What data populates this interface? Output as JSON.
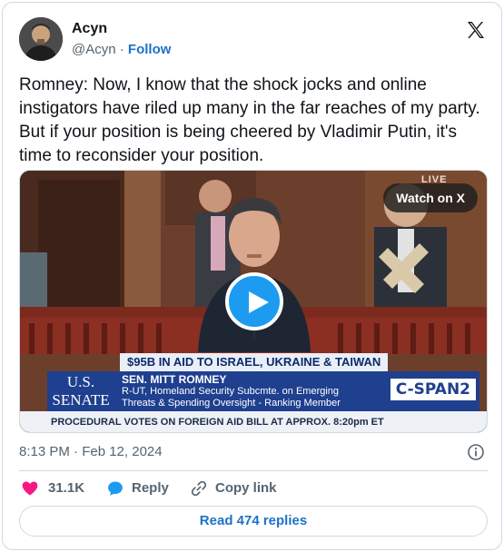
{
  "author": {
    "name": "Acyn",
    "handle": "@Acyn",
    "separator": "·",
    "follow_label": "Follow"
  },
  "tweet": {
    "text": "Romney: Now, I know that the shock jocks and online instigators have riled up many in the far reaches of my party. But if your position is being cheered by Vladimir Putin, it's time to reconsider your position.",
    "timestamp": "8:13 PM · Feb 12, 2024"
  },
  "media": {
    "watch_label": "Watch on X",
    "live_tag": "LIVE",
    "chyron_headline": "$95B IN AID TO ISRAEL, UKRAINE & TAIWAN",
    "senate_line1": "U.S.",
    "senate_line2": "SENATE",
    "speaker_name": "SEN. MITT ROMNEY",
    "speaker_desc1": "R-UT, Homeland Security Subcmte. on Emerging",
    "speaker_desc2": "Threats & Spending Oversight - Ranking Member",
    "network": "C-SPAN2",
    "ticker": "PROCEDURAL VOTES ON FOREIGN AID BILL AT APPROX. 8:20pm ET"
  },
  "actions": {
    "like_count": "31.1K",
    "reply_label": "Reply",
    "copy_label": "Copy link"
  },
  "read_replies_label": "Read 474 replies",
  "colors": {
    "accent": "#1d9bf0",
    "link": "#1d72c7",
    "like": "#f91880",
    "muted": "#536471",
    "border": "#cfd9de"
  },
  "icons": [
    "x-logo-icon",
    "play-icon",
    "info-icon",
    "heart-icon",
    "reply-bubble-icon",
    "link-icon"
  ]
}
